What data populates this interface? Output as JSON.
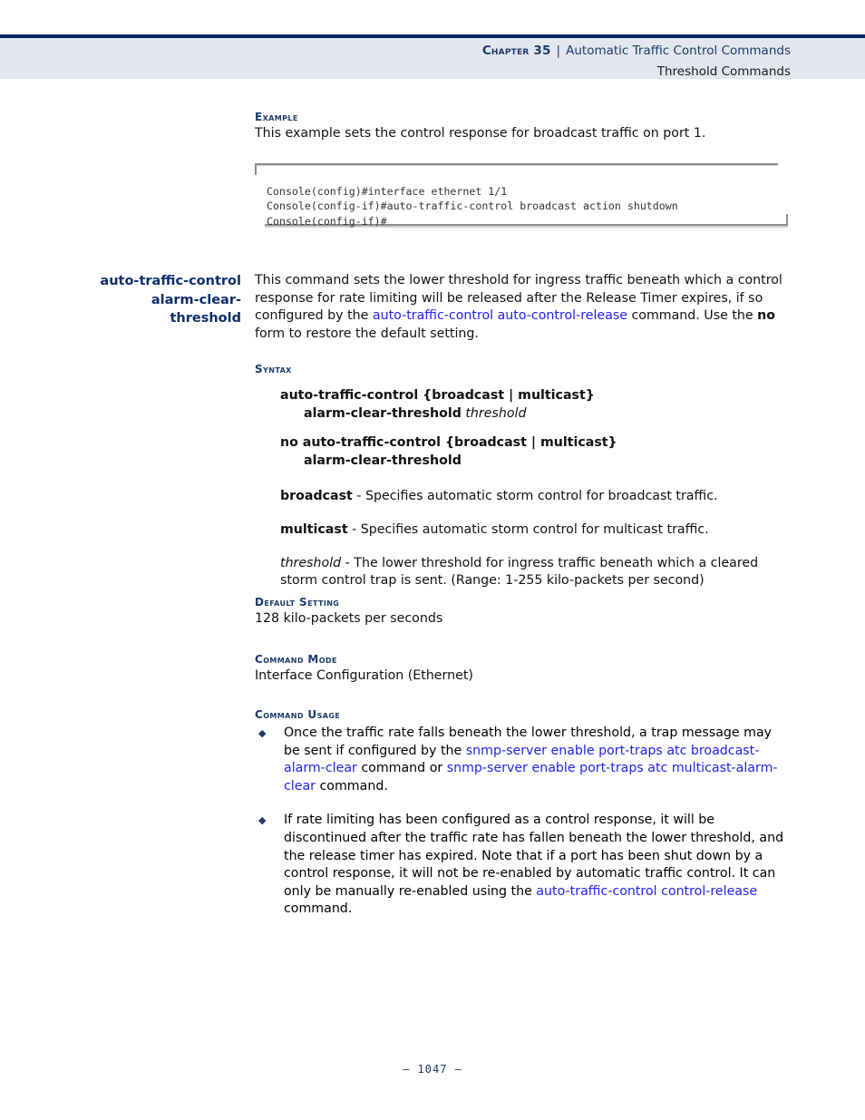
{
  "page": {
    "footer": "–  1047  –",
    "accent_navy": "#002868",
    "heading_navy": "#1b3a6b",
    "link_blue": "#2222ee",
    "header_band_bg": "#e4e7f0"
  },
  "header": {
    "chapter_label": "Chapter 35",
    "separator": "|",
    "chapter_title": "Automatic Traffic Control Commands",
    "subtitle": "Threshold Commands"
  },
  "example_section": {
    "heading": "Example",
    "description": "This example sets the control response for broadcast traffic on port 1.",
    "console_lines": [
      "Console(config)#interface ethernet 1/1",
      "Console(config-if)#auto-traffic-control broadcast action shutdown",
      "Console(config-if)#"
    ]
  },
  "command": {
    "margin_heading_lines": [
      "auto-traffic-control",
      "alarm-clear-",
      "threshold"
    ],
    "intro": {
      "part1": "This command sets the lower threshold for ingress traffic beneath which a control response for rate limiting will be released after the Release Timer expires, if so configured by the ",
      "link": "auto-traffic-control auto-control-release",
      "part2": " command. Use the ",
      "bold": "no",
      "part3": " form to restore the default setting."
    },
    "syntax": {
      "heading": "Syntax",
      "line1_bold_a": "auto-traffic-control",
      "line1_braces": " {broadcast | multicast}",
      "line2_bold": "alarm-clear-threshold",
      "line2_param": " threshold",
      "line3_bold_a": "no auto-traffic-control",
      "line3_braces": " {broadcast | multicast}",
      "line4_bold": "alarm-clear-threshold",
      "params": [
        {
          "term": "broadcast",
          "italic": false,
          "desc": " - Specifies automatic storm control for broadcast traffic."
        },
        {
          "term": "multicast",
          "italic": false,
          "desc": " - Specifies automatic storm control for multicast traffic."
        },
        {
          "term": "threshold",
          "italic": true,
          "desc": " - The lower threshold for ingress traffic beneath which a cleared storm control trap is sent. (Range: 1-255 kilo-packets per second)"
        }
      ]
    },
    "default_setting": {
      "heading": "Default Setting",
      "value": "128 kilo-packets per seconds"
    },
    "command_mode": {
      "heading": "Command Mode",
      "value": "Interface Configuration (Ethernet)"
    },
    "command_usage": {
      "heading": "Command Usage",
      "bullet_glyph": "◆",
      "bullets": [
        {
          "part1": "Once the traffic rate falls beneath the lower threshold, a trap message may be sent if configured by the ",
          "link1": "snmp-server enable port-traps atc broadcast-alarm-clear",
          "part2": " command or ",
          "link2": "snmp-server enable port-traps atc multicast-alarm-clear",
          "part3": " command."
        },
        {
          "part1": "If rate limiting has been configured as a control response, it will be discontinued after the traffic rate has fallen beneath the lower threshold, and the release timer has expired. Note that if a port has been shut down by a control response, it will not be re-enabled by automatic traffic control. It can only be manually re-enabled using the ",
          "link1": "auto-traffic-control control-release",
          "part2": " command.",
          "link2": "",
          "part3": ""
        }
      ]
    }
  }
}
